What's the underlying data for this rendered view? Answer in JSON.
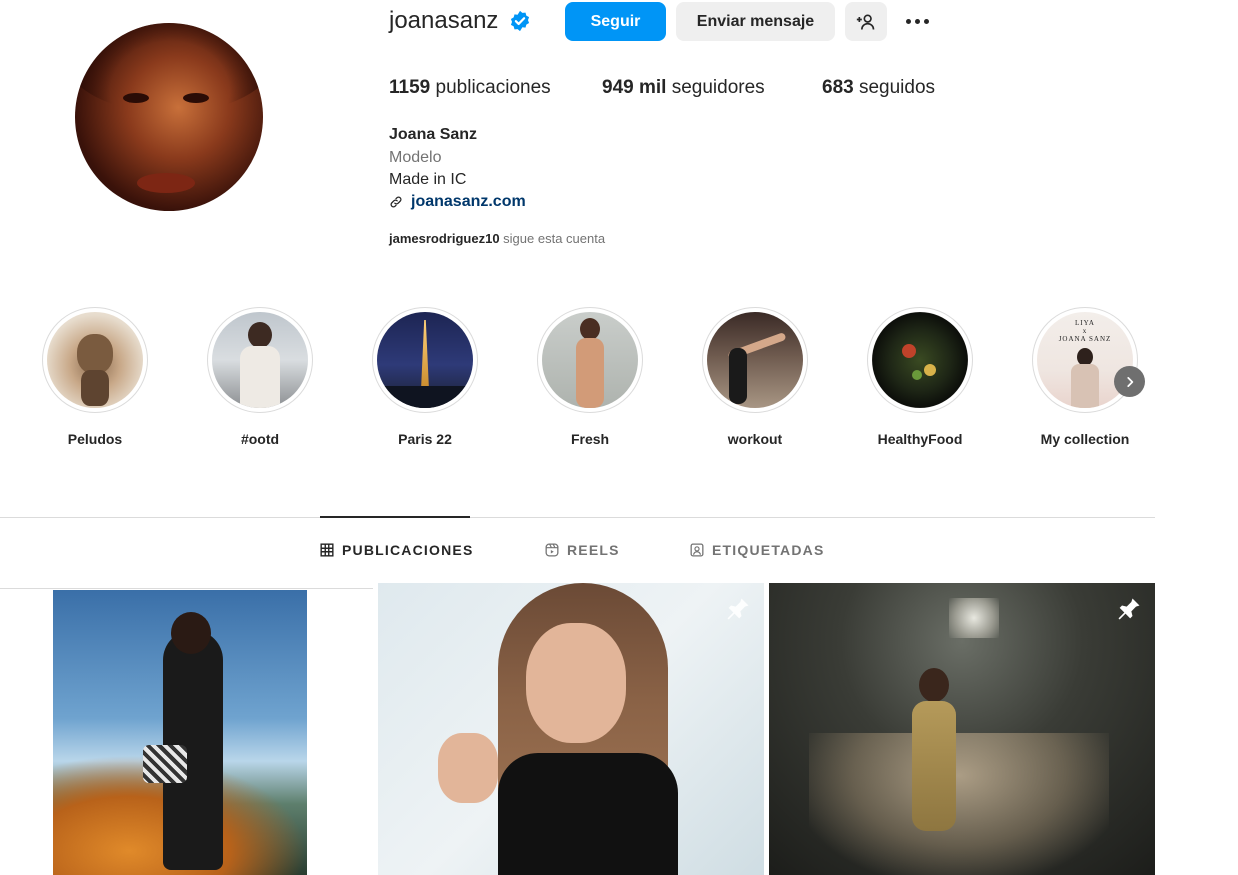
{
  "profile": {
    "username": "joanasanz",
    "verified": true,
    "follow_label": "Seguir",
    "message_label": "Enviar mensaje",
    "add_person_icon": "add-person-icon",
    "more_icon": "more-options-icon",
    "stats": {
      "posts_value": "1159",
      "posts_label": "publicaciones",
      "followers_value": "949 mil",
      "followers_label": "seguidores",
      "following_value": "683",
      "following_label": "seguidos"
    },
    "full_name": "Joana Sanz",
    "category": "Modelo",
    "bio": "Made in IC",
    "link": "joanasanz.com",
    "followed_by_user": "jamesrodriguez10",
    "followed_by_text": " sigue esta cuenta"
  },
  "highlights": [
    {
      "label": "Peludos"
    },
    {
      "label": "#ootd"
    },
    {
      "label": "Paris 22"
    },
    {
      "label": "Fresh"
    },
    {
      "label": "workout"
    },
    {
      "label": "HealthyFood"
    },
    {
      "label": "My collection",
      "overlay_line1": "LIYA",
      "overlay_line2": "x",
      "overlay_line3": "JOANA SANZ"
    }
  ],
  "tabs": {
    "posts": "PUBLICACIONES",
    "reels": "REELS",
    "tagged": "ETIQUETADAS",
    "active": "posts"
  },
  "posts": [
    {
      "pinned": false
    },
    {
      "pinned": true
    },
    {
      "pinned": true
    }
  ],
  "colors": {
    "accent": "#0095f6",
    "verified": "#0095f6",
    "link": "#00376b",
    "secondary_text": "#737373"
  }
}
